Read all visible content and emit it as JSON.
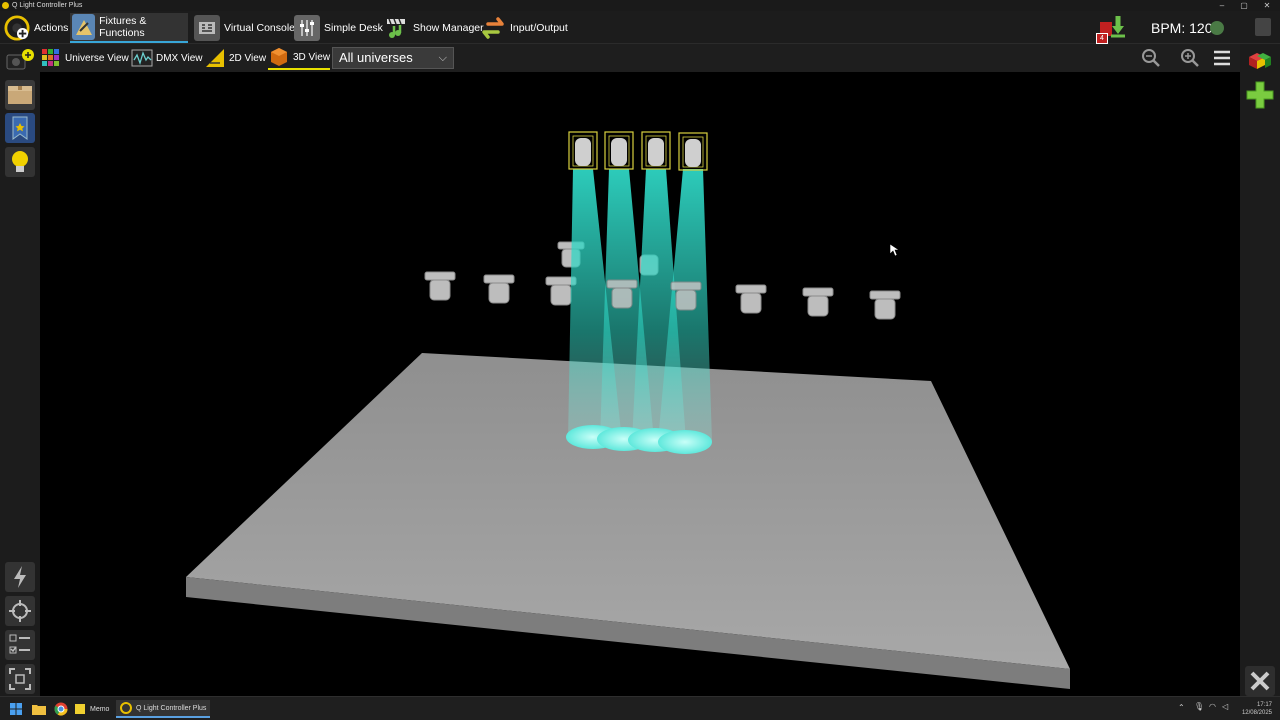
{
  "window": {
    "title": "Q Light Controller Plus",
    "controls": [
      "–",
      "▢",
      "✕"
    ]
  },
  "nav": {
    "tabs": [
      {
        "label": "Actions",
        "icon": "actions-icon",
        "active": false
      },
      {
        "label": "Fixtures & Functions",
        "icon": "fixtures-icon",
        "active": true
      },
      {
        "label": "Virtual Console",
        "icon": "virtual-console-icon",
        "active": false
      },
      {
        "label": "Simple Desk",
        "icon": "simple-desk-icon",
        "active": false
      },
      {
        "label": "Show Manager",
        "icon": "show-manager-icon",
        "active": false
      },
      {
        "label": "Input/Output",
        "icon": "input-output-icon",
        "active": false
      }
    ],
    "notification_badge": "4",
    "bpm_label": "BPM: 120"
  },
  "subnav": {
    "tabs": [
      {
        "label": "Universe View",
        "icon": "universe-grid-icon"
      },
      {
        "label": "DMX View",
        "icon": "dmx-view-icon"
      },
      {
        "label": "2D View",
        "icon": "2d-view-icon"
      },
      {
        "label": "3D View",
        "icon": "3d-view-icon",
        "active": true
      }
    ],
    "universe_select": {
      "value": "All universes"
    }
  },
  "colors": {
    "accent_blue": "#38a6d8",
    "active_yellow": "#e8e000",
    "beam": "#2fd6c4",
    "stage": "#9a9a9a"
  },
  "taskbar": {
    "items": [
      {
        "label": "Memo"
      },
      {
        "label": "Q Light Controller Plus",
        "active": true
      }
    ],
    "time": "17:17",
    "date": "12/08/2025"
  }
}
